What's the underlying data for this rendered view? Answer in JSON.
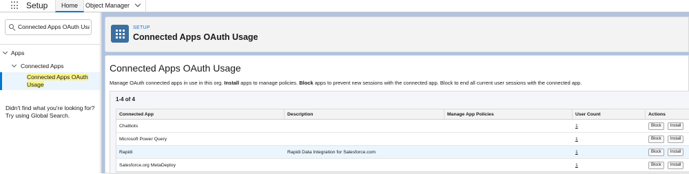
{
  "topbar": {
    "app_name": "Setup",
    "tabs": [
      {
        "label": "Home"
      },
      {
        "label": "Object Manager"
      }
    ]
  },
  "sidebar": {
    "search_value": "Connected Apps OAuth Usa",
    "tree": {
      "apps_label": "Apps",
      "connected_apps_label": "Connected Apps",
      "selected_label": "Connected Apps OAuth Usage"
    },
    "help_text": "Didn't find what you're looking for? Try using Global Search."
  },
  "header": {
    "section": "SETUP",
    "title": "Connected Apps OAuth Usage"
  },
  "content": {
    "title": "Connected Apps OAuth Usage",
    "description": {
      "part1": "Manage OAuth connected apps in use in this org. ",
      "install_word": "Install",
      "part2": " apps to manage policies. ",
      "block_word": "Block",
      "part3": " apps to prevent new sessions with the connected app. Block to end all current user sessions with the connected app."
    },
    "count": "1-4 of 4",
    "columns": {
      "app": "Connected App",
      "description": "Description",
      "policies": "Manage App Policies",
      "user_count": "User Count",
      "actions": "Actions"
    },
    "rows": [
      {
        "app": "Chatbots",
        "description": "",
        "policies": "",
        "user_count": "1",
        "block": "Block",
        "install": "Install"
      },
      {
        "app": "Microsoft Power Query",
        "description": "",
        "policies": "",
        "user_count": "1",
        "block": "Block",
        "install": "Install"
      },
      {
        "app": "Rapidi",
        "description": "Rapidi Data Integration for Salesforce.com",
        "policies": "",
        "user_count": "1",
        "block": "Block",
        "install": "Install"
      },
      {
        "app": "Salesforce.org MetaDeploy",
        "description": "",
        "policies": "",
        "user_count": "1",
        "block": "Block",
        "install": "Install"
      }
    ]
  },
  "colors": {
    "brand_blue": "#0176d3",
    "selected_bg": "#eaf5fe",
    "search_highlight": "#f9f38c",
    "main_bg": "#b0c4df"
  }
}
